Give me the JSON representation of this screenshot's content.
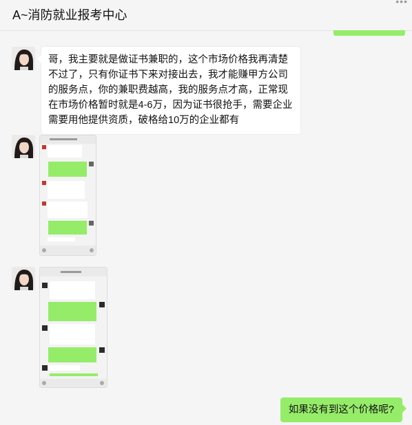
{
  "chat": {
    "title": "A~消防就业报考中心",
    "more_icon": "more-dots-icon"
  },
  "messages": {
    "m1": {
      "text": "哥，我主要就是做证书兼职的，这个市场价格我再清楚不过了，只有你证书下来对接出去，我才能赚甲方公司的服务点，你的兼职费越高，我的服务点才高，正常现在市场价格暂时就是4-6万，因为证书很抢手，需要企业需要用他提供资质，破格给10万的企业都有"
    },
    "m2": {
      "type": "screenshot-image",
      "icon": "chat-screenshot-icon"
    },
    "m3": {
      "type": "screenshot-image",
      "icon": "chat-screenshot-icon"
    },
    "m4": {
      "text": "如果没有到这个价格呢?"
    }
  },
  "colors": {
    "sent_bubble": "#95ec69",
    "received_bubble": "#ffffff",
    "background": "#f5f5f5"
  }
}
